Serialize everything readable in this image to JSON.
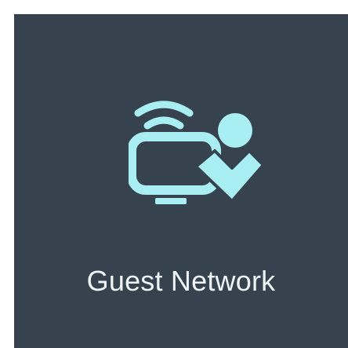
{
  "tile": {
    "label": "Guest Network",
    "icon": "guest-network-icon",
    "background_color": "#36434e",
    "icon_color": "#a9eef2",
    "label_color": "#eef3f5"
  }
}
